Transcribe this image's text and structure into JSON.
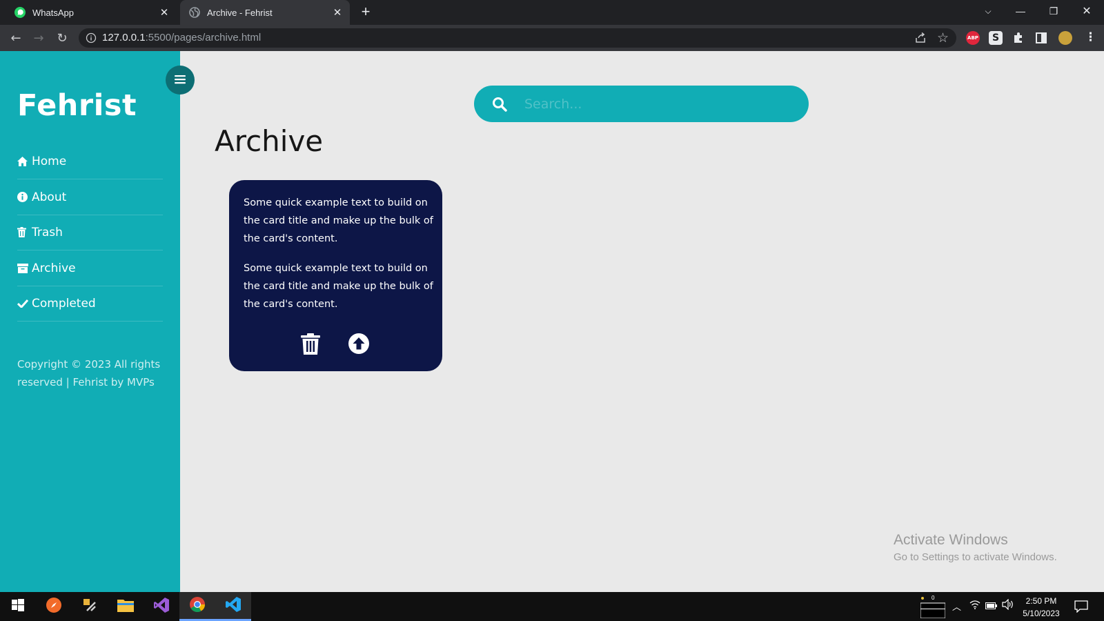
{
  "browser": {
    "tabs": [
      {
        "title": "WhatsApp",
        "active": false,
        "icon": "whatsapp-icon"
      },
      {
        "title": "Archive - Fehrist",
        "active": true,
        "icon": "globe-icon"
      }
    ],
    "url_host": "127.0.0.1",
    "url_path": ":5500/pages/archive.html"
  },
  "sidebar": {
    "brand": "Fehrist",
    "items": [
      {
        "label": "Home",
        "icon": "home-icon"
      },
      {
        "label": "About",
        "icon": "info-icon"
      },
      {
        "label": "Trash",
        "icon": "trash-icon"
      },
      {
        "label": "Archive",
        "icon": "archive-icon"
      },
      {
        "label": "Completed",
        "icon": "check-icon"
      }
    ],
    "copyright": "Copyright © 2023 All rights reserved | Fehrist by MVPs"
  },
  "main": {
    "search_placeholder": "Search...",
    "title": "Archive",
    "cards": [
      {
        "paragraphs": [
          "Some quick example text to build on the card title and make up the bulk of the card's content.",
          "Some quick example text to build on the card title and make up the bulk of the card's content."
        ]
      }
    ]
  },
  "watermark": {
    "title": "Activate Windows",
    "subtitle": "Go to Settings to activate Windows."
  },
  "taskbar": {
    "time": "2:50 PM",
    "date": "5/10/2023",
    "badge": "0"
  },
  "colors": {
    "accent": "#11adb5",
    "card": "#0d1647",
    "background": "#e9e9e9"
  }
}
